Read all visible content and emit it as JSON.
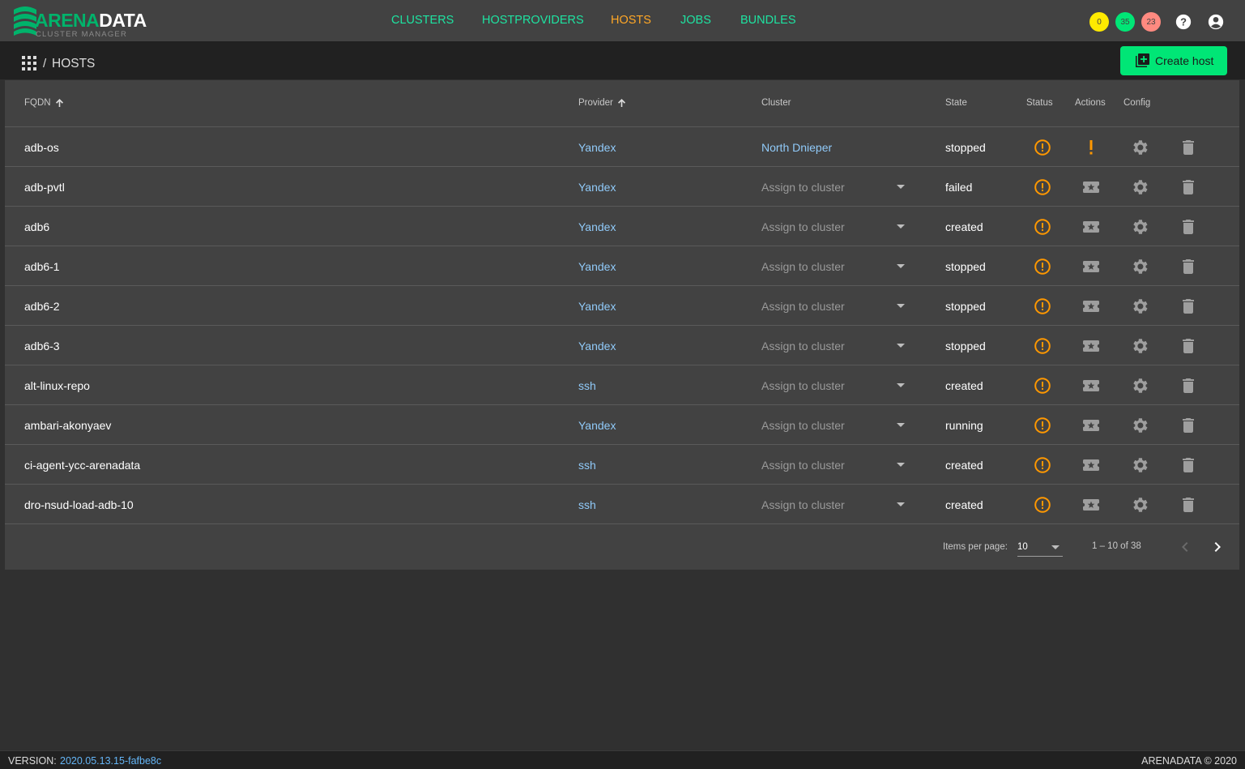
{
  "app": {
    "logo_primary": "ARENA",
    "logo_secondary": "DATA",
    "logo_subtitle": "CLUSTER MANAGER"
  },
  "nav": {
    "items": [
      {
        "label": "CLUSTERS",
        "active": false
      },
      {
        "label": "HOSTPROVIDERS",
        "active": false
      },
      {
        "label": "HOSTS",
        "active": true
      },
      {
        "label": "JOBS",
        "active": false
      },
      {
        "label": "BUNDLES",
        "active": false
      }
    ]
  },
  "header": {
    "badges": [
      {
        "value": "0",
        "color": "#ffea00"
      },
      {
        "value": "35",
        "color": "#00e676"
      },
      {
        "value": "23",
        "color": "#ff8a80"
      }
    ],
    "help_icon": "help-icon",
    "account_icon": "account-circle-icon"
  },
  "breadcrumb": {
    "separator": "/",
    "current": "HOSTS"
  },
  "toolbar": {
    "create_label": "Create host"
  },
  "table": {
    "columns": {
      "fqdn": "FQDN",
      "provider": "Provider",
      "cluster": "Cluster",
      "state": "State",
      "status": "Status",
      "actions": "Actions",
      "config": "Config"
    },
    "assign_placeholder": "Assign to cluster",
    "rows": [
      {
        "fqdn": "adb-os",
        "provider": "Yandex",
        "cluster": "North Dnieper",
        "state": "stopped",
        "action_warning": true
      },
      {
        "fqdn": "adb-pvtl",
        "provider": "Yandex",
        "cluster": "",
        "state": "failed",
        "action_warning": false
      },
      {
        "fqdn": "adb6",
        "provider": "Yandex",
        "cluster": "",
        "state": "created",
        "action_warning": false
      },
      {
        "fqdn": "adb6-1",
        "provider": "Yandex",
        "cluster": "",
        "state": "stopped",
        "action_warning": false
      },
      {
        "fqdn": "adb6-2",
        "provider": "Yandex",
        "cluster": "",
        "state": "stopped",
        "action_warning": false
      },
      {
        "fqdn": "adb6-3",
        "provider": "Yandex",
        "cluster": "",
        "state": "stopped",
        "action_warning": false
      },
      {
        "fqdn": "alt-linux-repo",
        "provider": "ssh",
        "cluster": "",
        "state": "created",
        "action_warning": false
      },
      {
        "fqdn": "ambari-akonyaev",
        "provider": "Yandex",
        "cluster": "",
        "state": "running",
        "action_warning": false
      },
      {
        "fqdn": "ci-agent-ycc-arenadata",
        "provider": "ssh",
        "cluster": "",
        "state": "created",
        "action_warning": false
      },
      {
        "fqdn": "dro-nsud-load-adb-10",
        "provider": "ssh",
        "cluster": "",
        "state": "created",
        "action_warning": false
      }
    ]
  },
  "paginator": {
    "items_per_page_label": "Items per page:",
    "items_per_page": "10",
    "range": "1 – 10 of 38"
  },
  "footer": {
    "version_label": "VERSION:",
    "version": "2020.05.13.15-fafbe8c",
    "copyright": "ARENADATA © 2020"
  },
  "colors": {
    "accent_green": "#00e676",
    "nav_green": "#1ee3a1",
    "active_orange": "#ffa726",
    "link_blue": "#90caf9",
    "status_orange": "#ff9800"
  }
}
